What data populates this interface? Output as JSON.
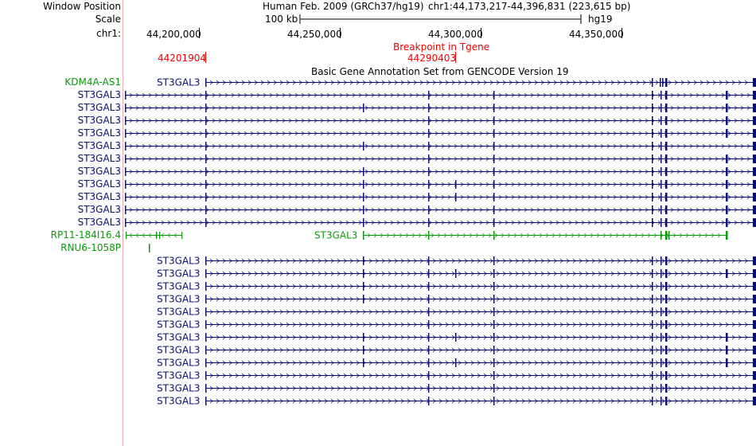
{
  "labels": {
    "window_position": "Window Position",
    "scale": "Scale",
    "chrom": "chr1:"
  },
  "header": {
    "assembly": "Human Feb. 2009 (GRCh37/hg19)",
    "position": "chr1:44,173,217-44,396,831 (223,615 bp)",
    "scale_text": "100 kb",
    "db": "hg19",
    "ticks": [
      "44,200,000",
      "44,250,000",
      "44,300,000",
      "44,350,000"
    ]
  },
  "breakpoint": {
    "title": "Breakpoint in Tgene",
    "left_label": "44201904",
    "right_label": "44290403"
  },
  "track_title": "Basic Gene Annotation Set from GENCODE Version 19",
  "colors": {
    "navy": "#0c0c78",
    "green": "#0a9a0a",
    "red": "#ee0000",
    "guide": "#e8a8a8",
    "black": "#000000"
  },
  "gene_rows": [
    {
      "left_label": "KDM4A-AS1",
      "left_color": "green",
      "inline_label": "ST3GAL3",
      "inline_color": "navy",
      "variant": "a"
    },
    {
      "left_label": "ST3GAL3",
      "left_color": "navy",
      "inline_label": "",
      "variant": "b"
    },
    {
      "left_label": "ST3GAL3",
      "left_color": "navy",
      "inline_label": "",
      "variant": "c"
    },
    {
      "left_label": "ST3GAL3",
      "left_color": "navy",
      "inline_label": "",
      "variant": "d"
    },
    {
      "left_label": "ST3GAL3",
      "left_color": "navy",
      "inline_label": "",
      "variant": "e"
    },
    {
      "left_label": "ST3GAL3",
      "left_color": "navy",
      "inline_label": "",
      "variant": "f"
    },
    {
      "left_label": "ST3GAL3",
      "left_color": "navy",
      "inline_label": "",
      "variant": "b"
    },
    {
      "left_label": "ST3GAL3",
      "left_color": "navy",
      "inline_label": "",
      "variant": "g"
    },
    {
      "left_label": "ST3GAL3",
      "left_color": "navy",
      "inline_label": "",
      "variant": "h"
    },
    {
      "left_label": "ST3GAL3",
      "left_color": "navy",
      "inline_label": "",
      "variant": "h"
    },
    {
      "left_label": "ST3GAL3",
      "left_color": "navy",
      "inline_label": "",
      "variant": "c"
    },
    {
      "left_label": "ST3GAL3",
      "left_color": "navy",
      "inline_label": "",
      "variant": "i"
    },
    {
      "left_label": "RP11-184I16.4",
      "left_color": "green",
      "inline_label": "ST3GAL3",
      "inline_color": "green",
      "variant": "green"
    },
    {
      "left_label": "RNU6-1058P",
      "left_color": "green",
      "inline_label": "",
      "variant": "small"
    },
    {
      "left_label": "",
      "inline_label": "ST3GAL3",
      "inline_color": "navy",
      "variant": "j"
    },
    {
      "left_label": "",
      "inline_label": "ST3GAL3",
      "inline_color": "navy",
      "variant": "k"
    },
    {
      "left_label": "",
      "inline_label": "ST3GAL3",
      "inline_color": "navy",
      "variant": "l"
    },
    {
      "left_label": "",
      "inline_label": "ST3GAL3",
      "inline_color": "navy",
      "variant": "m"
    },
    {
      "left_label": "",
      "inline_label": "ST3GAL3",
      "inline_color": "navy",
      "variant": "n"
    },
    {
      "left_label": "",
      "inline_label": "ST3GAL3",
      "inline_color": "navy",
      "variant": "o"
    },
    {
      "left_label": "",
      "inline_label": "ST3GAL3",
      "inline_color": "navy",
      "variant": "p"
    },
    {
      "left_label": "",
      "inline_label": "ST3GAL3",
      "inline_color": "navy",
      "variant": "q"
    },
    {
      "left_label": "",
      "inline_label": "ST3GAL3",
      "inline_color": "navy",
      "variant": "r"
    },
    {
      "left_label": "",
      "inline_label": "ST3GAL3",
      "inline_color": "navy",
      "variant": "s"
    },
    {
      "left_label": "",
      "inline_label": "ST3GAL3",
      "inline_color": "navy",
      "variant": "n"
    },
    {
      "left_label": "",
      "inline_label": "ST3GAL3",
      "inline_color": "navy",
      "variant": "n"
    }
  ]
}
